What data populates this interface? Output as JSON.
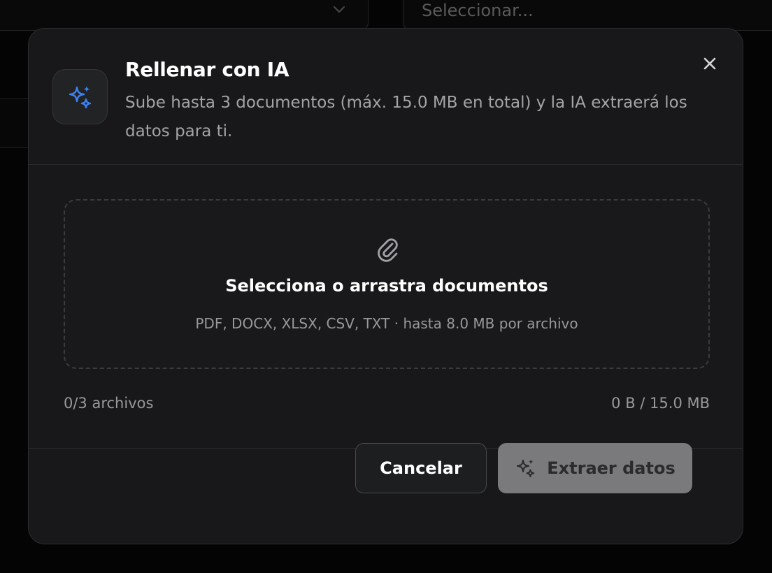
{
  "background": {
    "select_placeholder": "Seleccionar..."
  },
  "dialog": {
    "title": "Rellenar con IA",
    "subtitle": "Sube hasta 3 documentos (máx. 15.0 MB en total) y la IA extraerá los datos para ti.",
    "header_icon": "sparkles-icon",
    "close_icon": "close-icon"
  },
  "dropzone": {
    "icon": "paperclip-icon",
    "title": "Selecciona o arrastra documentos",
    "hint": "PDF, DOCX, XLSX, CSV, TXT · hasta 8.0 MB por archivo"
  },
  "counters": {
    "files": "0/3 archivos",
    "size": "0 B / 15.0 MB"
  },
  "actions": {
    "cancel_label": "Cancelar",
    "extract_label": "Extraer datos",
    "extract_icon": "sparkles-icon"
  },
  "colors": {
    "accent_blue": "#3b82f6",
    "disabled_button": "#7a7a7c",
    "modal_bg": "#18181a"
  }
}
